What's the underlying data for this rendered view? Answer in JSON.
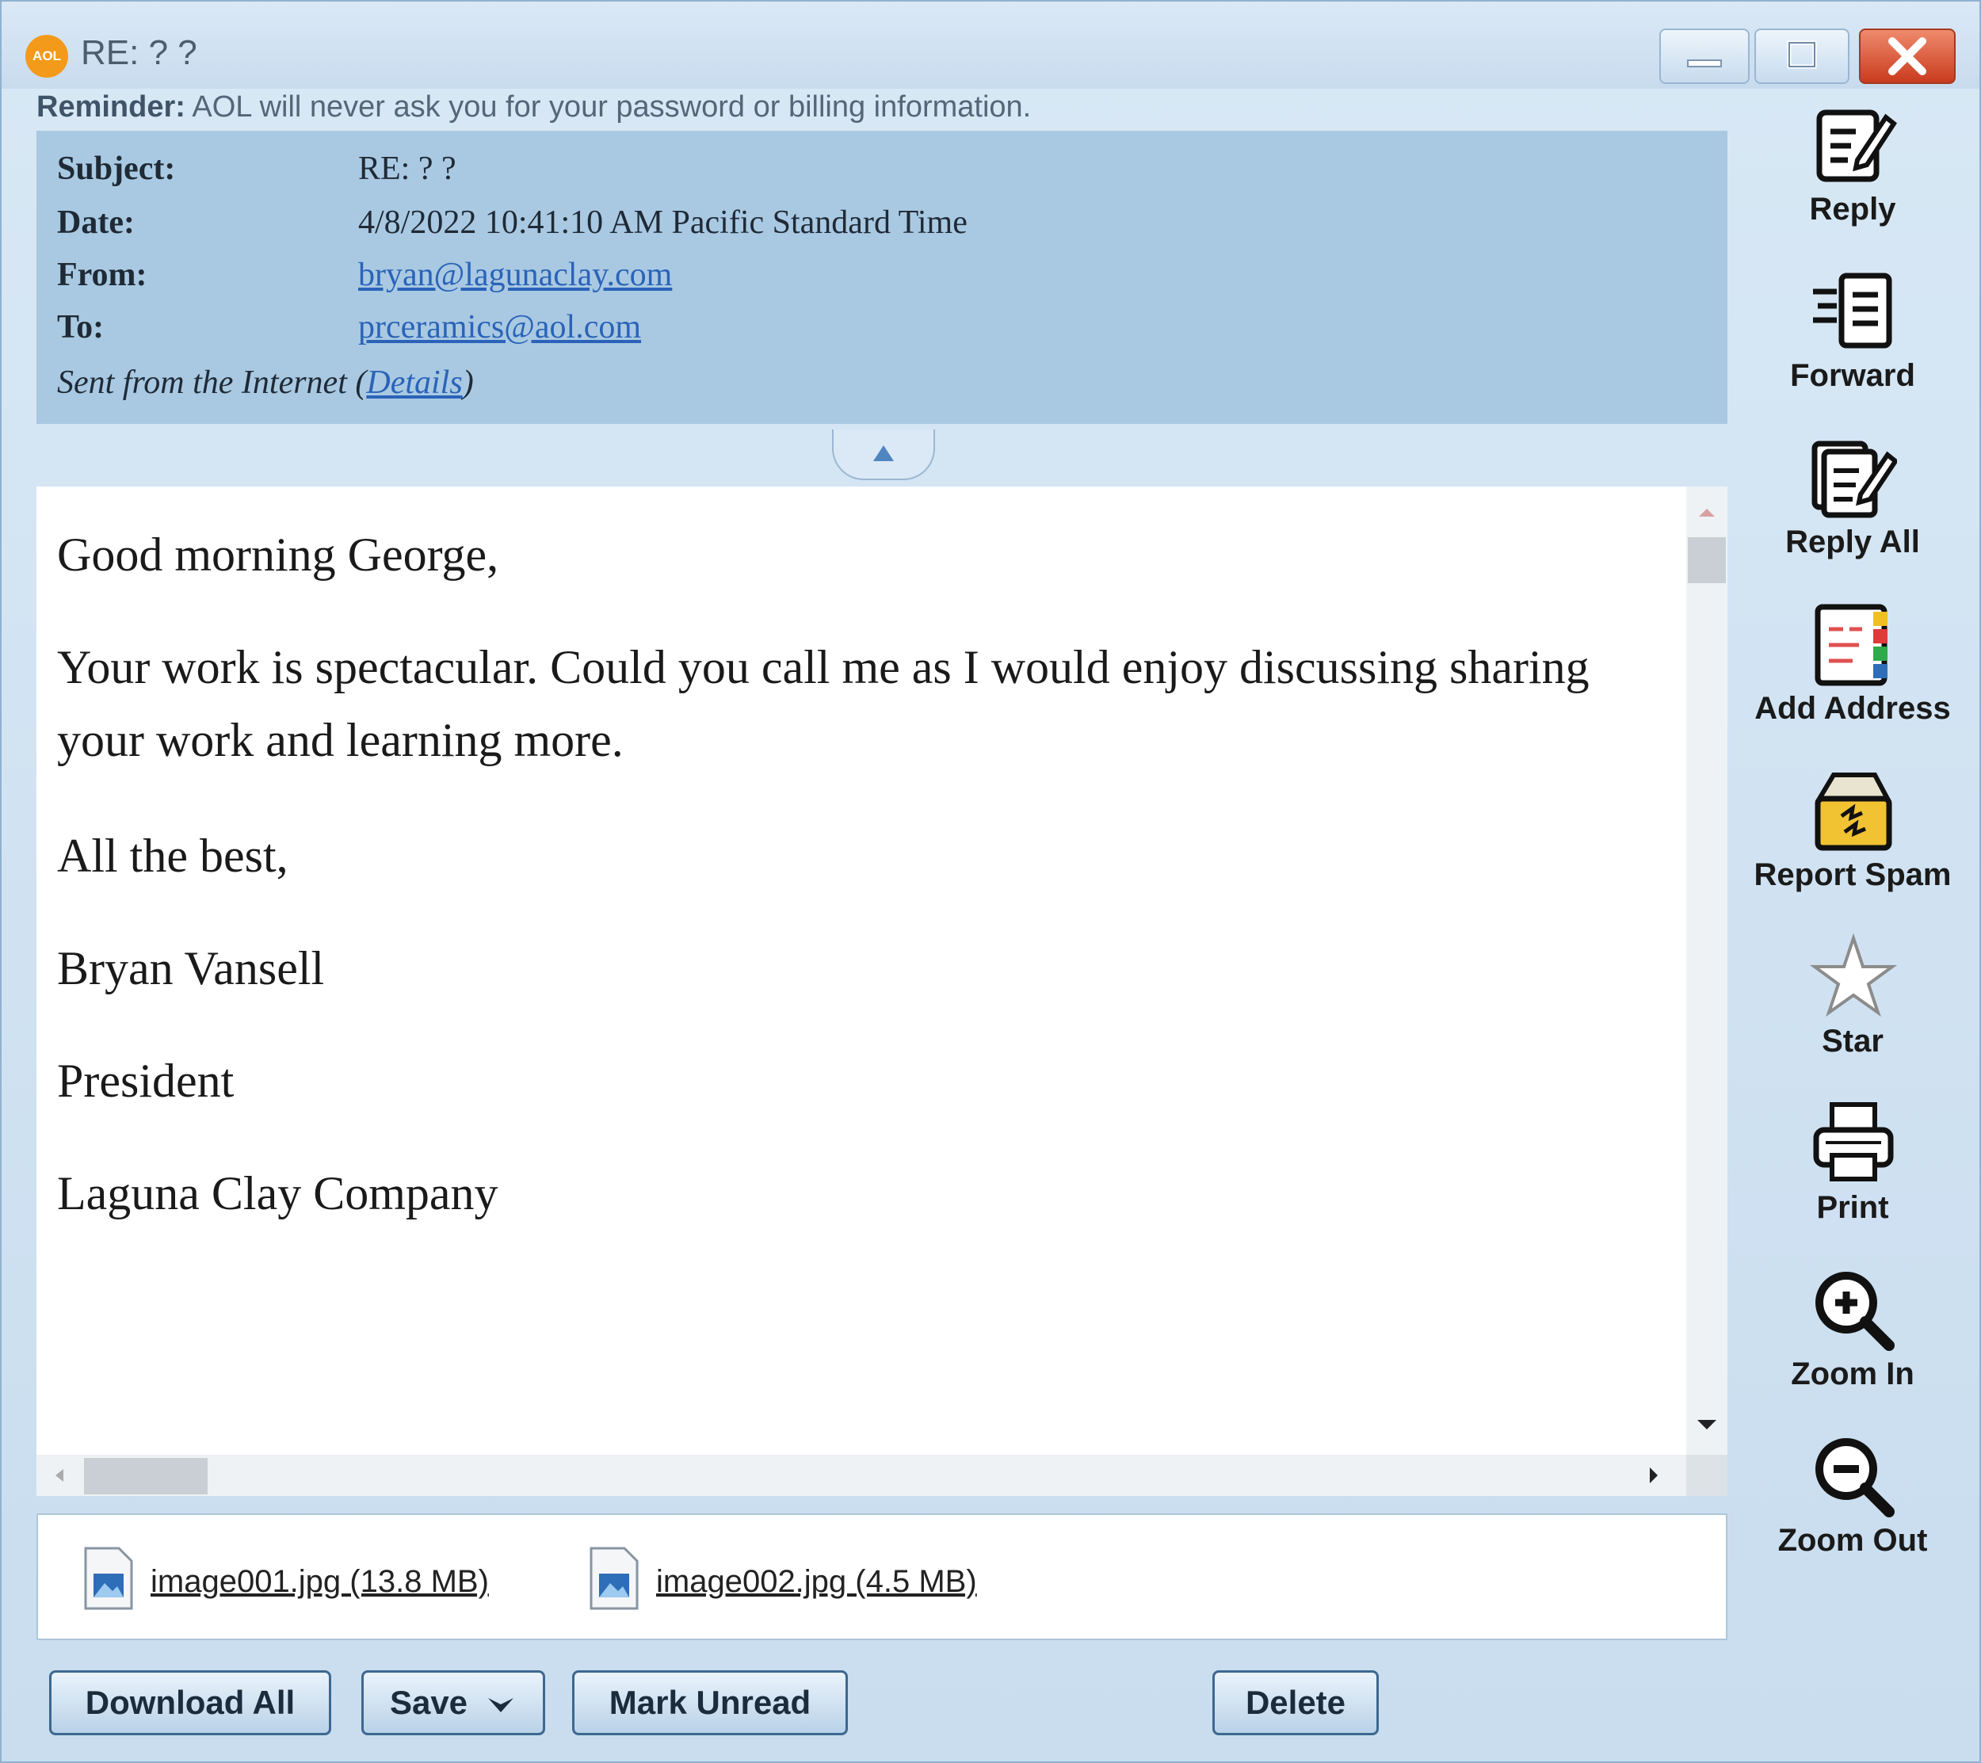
{
  "window": {
    "title": "RE: ? ?",
    "badge": "AOL"
  },
  "reminder": {
    "label": "Reminder:",
    "text": "AOL will never ask you for your password or billing information."
  },
  "header": {
    "subject_label": "Subject:",
    "subject": "RE: ? ?",
    "date_label": "Date:",
    "date": "4/8/2022 10:41:10 AM Pacific Standard Time",
    "from_label": "From:",
    "from": "bryan@lagunaclay.com",
    "to_label": "To:",
    "to": "prceramics@aol.com",
    "sent_prefix": "Sent from the Internet (",
    "details_link": "Details",
    "sent_suffix": ")"
  },
  "message": {
    "greeting": "Good morning George,",
    "body": "Your work is spectacular. Could you call me as I would enjoy discussing sharing your work and learning more.",
    "closing": "All the best,",
    "name": "Bryan Vansell",
    "title": "President",
    "company": "Laguna Clay Company"
  },
  "attachments": [
    {
      "name": "image001.jpg (13.8 MB)",
      "icon": "image-file-icon"
    },
    {
      "name": "image002.jpg (4.5 MB)",
      "icon": "image-file-icon"
    }
  ],
  "buttons": {
    "download_all": "Download All",
    "save": "Save",
    "mark_unread": "Mark Unread",
    "delete": "Delete"
  },
  "toolbar": [
    {
      "label": "Reply",
      "icon": "reply-icon"
    },
    {
      "label": "Forward",
      "icon": "forward-icon"
    },
    {
      "label": "Reply All",
      "icon": "reply-all-icon"
    },
    {
      "label": "Add Address",
      "icon": "address-book-icon"
    },
    {
      "label": "Report Spam",
      "icon": "spam-icon"
    },
    {
      "label": "Star",
      "icon": "star-icon"
    },
    {
      "label": "Print",
      "icon": "printer-icon"
    },
    {
      "label": "Zoom In",
      "icon": "zoom-in-icon"
    },
    {
      "label": "Zoom Out",
      "icon": "zoom-out-icon"
    }
  ],
  "colors": {
    "header_bg": "#a9c9e2",
    "link": "#2a63b8",
    "aol_orange": "#f39a1a",
    "close_red": "#c93b1e"
  }
}
